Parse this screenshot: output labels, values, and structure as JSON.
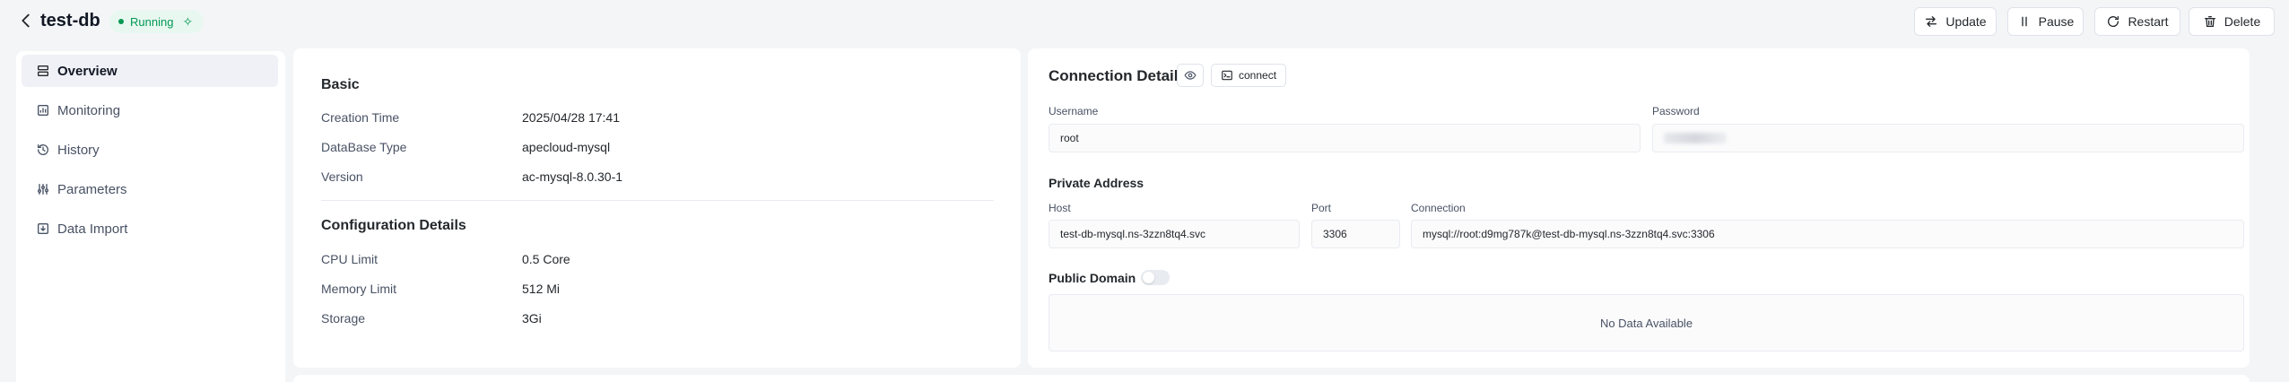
{
  "header": {
    "title": "test-db",
    "status": "Running",
    "buttons": {
      "update": "Update",
      "pause": "Pause",
      "restart": "Restart",
      "delete": "Delete"
    }
  },
  "sidebar": {
    "items": [
      {
        "label": "Overview",
        "icon": "list-icon",
        "active": true
      },
      {
        "label": "Monitoring",
        "icon": "chart-icon",
        "active": false
      },
      {
        "label": "History",
        "icon": "history-icon",
        "active": false
      },
      {
        "label": "Parameters",
        "icon": "sliders-icon",
        "active": false
      },
      {
        "label": "Data Import",
        "icon": "import-icon",
        "active": false
      }
    ]
  },
  "basic": {
    "title": "Basic",
    "rows": [
      {
        "label": "Creation Time",
        "value": "2025/04/28 17:41"
      },
      {
        "label": "DataBase Type",
        "value": "apecloud-mysql"
      },
      {
        "label": "Version",
        "value": "ac-mysql-8.0.30-1"
      }
    ]
  },
  "config": {
    "title": "Configuration Details",
    "rows": [
      {
        "label": "CPU Limit",
        "value": "0.5 Core"
      },
      {
        "label": "Memory Limit",
        "value": "512 Mi"
      },
      {
        "label": "Storage",
        "value": "3Gi"
      }
    ]
  },
  "connection": {
    "title": "Connection Details",
    "connect_label": "connect",
    "username_label": "Username",
    "username": "root",
    "password_label": "Password",
    "private_title": "Private Address",
    "host_label": "Host",
    "host": "test-db-mysql.ns-3zzn8tq4.svc",
    "port_label": "Port",
    "port": "3306",
    "conn_label": "Connection",
    "conn": "mysql://root:d9mg787k@test-db-mysql.ns-3zzn8tq4.svc:3306",
    "public_title": "Public Domain",
    "public_enabled": false,
    "empty_text": "No Data Available"
  },
  "colors": {
    "accent_green": "#039855",
    "page_bg": "#f4f5f7",
    "card_bg": "#ffffff"
  }
}
